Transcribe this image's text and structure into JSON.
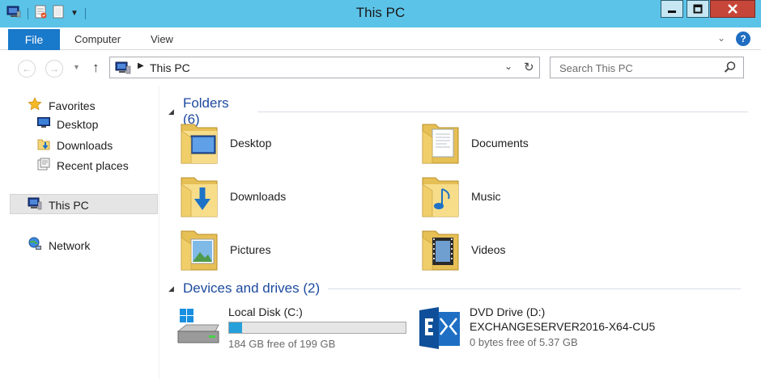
{
  "window": {
    "title": "This PC"
  },
  "ribbon": {
    "tabs": [
      {
        "label": "File"
      },
      {
        "label": "Computer"
      },
      {
        "label": "View"
      }
    ]
  },
  "address_bar": {
    "path": "This PC"
  },
  "search": {
    "placeholder": "Search This PC"
  },
  "nav_pane": {
    "favorites_label": "Favorites",
    "favorites": [
      {
        "label": "Desktop"
      },
      {
        "label": "Downloads"
      },
      {
        "label": "Recent places"
      }
    ],
    "this_pc_label": "This PC",
    "network_label": "Network"
  },
  "folders_group": {
    "label": "Folders (6)",
    "items": [
      {
        "label": "Desktop",
        "icon": "desktop-folder-icon"
      },
      {
        "label": "Documents",
        "icon": "documents-folder-icon"
      },
      {
        "label": "Downloads",
        "icon": "downloads-folder-icon"
      },
      {
        "label": "Music",
        "icon": "music-folder-icon"
      },
      {
        "label": "Pictures",
        "icon": "pictures-folder-icon"
      },
      {
        "label": "Videos",
        "icon": "videos-folder-icon"
      }
    ]
  },
  "drives_group": {
    "label": "Devices and drives (2)",
    "items": [
      {
        "name": "Local Disk (C:)",
        "free": "184 GB free of 199 GB",
        "used_fraction": 0.075
      },
      {
        "name": "DVD Drive (D:)",
        "volume": "EXCHANGESERVER2016-X64-CU5",
        "free": "0 bytes free of 5.37 GB"
      }
    ]
  },
  "colors": {
    "titlebar": "#5bc3e8",
    "file_tab": "#1979ca",
    "group_heading": "#1c4a9e",
    "drive_bar": "#26a0da",
    "close_button": "#c7463a"
  }
}
